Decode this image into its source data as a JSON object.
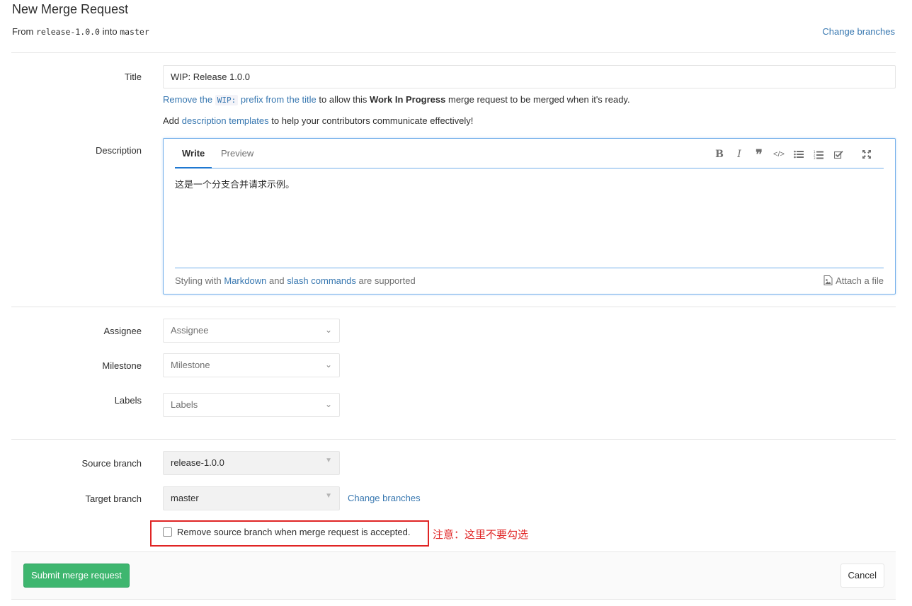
{
  "header": {
    "title": "New Merge Request",
    "from_label": "From",
    "source_branch": "release-1.0.0",
    "into_label": "into",
    "target_branch": "master",
    "change_branches": "Change branches"
  },
  "form": {
    "title_label": "Title",
    "title_value": "WIP: Release 1.0.0",
    "wip_hint": {
      "link_prefix": "Remove the",
      "code": "WIP:",
      "link_suffix": "prefix from the title",
      "text1": "to allow this",
      "bold": "Work In Progress",
      "text2": "merge request to be merged when it's ready."
    },
    "template_hint": {
      "before": "Add",
      "link": "description templates",
      "after": "to help your contributors communicate effectively!"
    },
    "description_label": "Description",
    "tabs": [
      "Write",
      "Preview"
    ],
    "toolbar_icons": [
      "bold-icon",
      "italic-icon",
      "quote-icon",
      "code-icon",
      "bullet-list-icon",
      "numbered-list-icon",
      "task-list-icon",
      "fullscreen-icon"
    ],
    "description_value": "这是一个分支合并请求示例。",
    "md_footer": {
      "before": "Styling with",
      "markdown_link": "Markdown",
      "and": "and",
      "slash_link": "slash commands",
      "after": "are supported",
      "attach": "Attach a file"
    },
    "assignee_label": "Assignee",
    "assignee_placeholder": "Assignee",
    "milestone_label": "Milestone",
    "milestone_placeholder": "Milestone",
    "labels_label": "Labels",
    "labels_placeholder": "Labels",
    "source_branch_label": "Source branch",
    "source_branch_value": "release-1.0.0",
    "target_branch_label": "Target branch",
    "target_branch_value": "master",
    "change_branches": "Change branches",
    "remove_source_label": "Remove source branch when merge request is accepted.",
    "note": "注意：这里不要勾选"
  },
  "actions": {
    "submit": "Submit merge request",
    "cancel": "Cancel"
  },
  "colors": {
    "link": "#3777b0",
    "submit_bg": "#3eb66f",
    "focus_border": "#73afea",
    "annotation_red": "#e02424"
  }
}
